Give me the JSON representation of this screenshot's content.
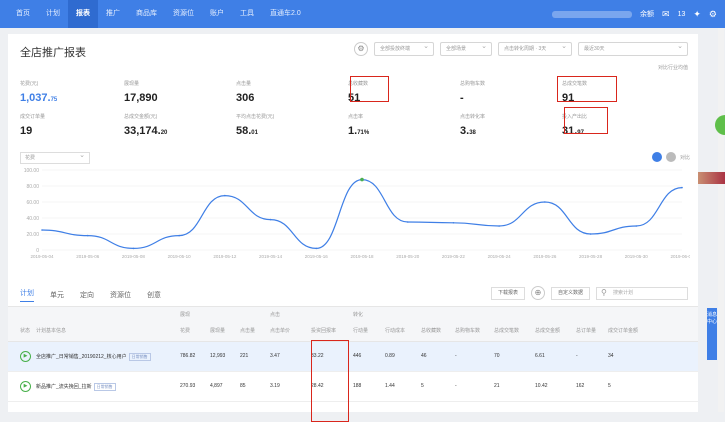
{
  "nav": {
    "items": [
      "首页",
      "计划",
      "报表",
      "推广",
      "商品库",
      "资源位",
      "账户",
      "工具",
      "直通车2.0"
    ],
    "active_index": 2,
    "right": {
      "amount": "余额",
      "msg_count": "13"
    }
  },
  "page": {
    "title": "全店推广报表",
    "filters": [
      "全部投放终端",
      "全部场景",
      "点击转化周期 · 3天",
      "最近30天"
    ],
    "compare_label": "对比行业均值"
  },
  "metrics": [
    {
      "label": "花费(元)",
      "value": "1,037.",
      "small": "75",
      "blue": true
    },
    {
      "label": "展现量",
      "value": "17,890",
      "small": ""
    },
    {
      "label": "点击量",
      "value": "306",
      "small": ""
    },
    {
      "label": "总收藏数",
      "value": "51",
      "small": ""
    },
    {
      "label": "总购物车数",
      "value": "-",
      "small": ""
    },
    {
      "label": "总成交笔数",
      "value": "91",
      "small": ""
    },
    {
      "label": "成交订单量",
      "value": "19",
      "small": ""
    },
    {
      "label": "总成交金额(元)",
      "value": "33,174.",
      "small": "20"
    },
    {
      "label": "平均点击花费(元)",
      "value": "58.",
      "small": "01"
    },
    {
      "label": "点击率",
      "value": "1.",
      "small": "71%"
    },
    {
      "label": "点击转化率",
      "value": "3.",
      "small": "38"
    },
    {
      "label": "投入产出比",
      "value": "31.",
      "small": "97"
    }
  ],
  "chart": {
    "metric_select": "花费",
    "compare_label": "对比"
  },
  "chart_data": {
    "type": "line",
    "ylim": [
      0,
      100
    ],
    "yticks": [
      "100.00",
      "80.00",
      "60.00",
      "40.00",
      "20.00",
      "0"
    ],
    "x": [
      "2019-05-04",
      "2019-05-06",
      "2019-05-08",
      "2019-05-10",
      "2019-05-12",
      "2019-05-14",
      "2019-05-16",
      "2019-05-18",
      "2019-05-20",
      "2019-05-22",
      "2019-05-24",
      "2019-05-26",
      "2019-05-28",
      "2019-05-30",
      "2019-06-01"
    ],
    "series": [
      {
        "values": [
          25,
          18,
          2,
          18,
          68,
          38,
          2,
          88,
          35,
          34,
          30,
          60,
          20,
          30,
          78
        ]
      }
    ]
  },
  "table": {
    "tabs": [
      "计划",
      "单元",
      "定向",
      "资源位",
      "创意"
    ],
    "tools": [
      "下载报表",
      "自定义数据"
    ],
    "search_placeholder": "搜索计划",
    "groups": [
      "展现",
      "点击",
      "转化"
    ],
    "headers": [
      "状态",
      "计划基本信息",
      "花费",
      "展现量",
      "点击量",
      "点击单价",
      "投资回报率",
      "行动量",
      "行动成本",
      "总收藏数",
      "总购物车数",
      "总成交笔数",
      "总成交金额",
      "总订单量",
      "成交订单金额"
    ],
    "rows": [
      {
        "name": "全店推广_日常销售_20190212_核心用户",
        "badge": "日常销售",
        "vals": [
          "786.82",
          "12,993",
          "221",
          "3.47",
          "33.22",
          "446",
          "0.89",
          "46",
          "-",
          "70",
          "6.61",
          "-",
          "34"
        ]
      },
      {
        "name": "新品推广_流失挽回_拉新",
        "badge": "日常销售",
        "vals": [
          "270.93",
          "4,897",
          "85",
          "3.19",
          "28.42",
          "188",
          "1.44",
          "5",
          "-",
          "21",
          "10.42",
          "162",
          "5"
        ]
      }
    ]
  },
  "side": {
    "float_label": "消息中心"
  }
}
